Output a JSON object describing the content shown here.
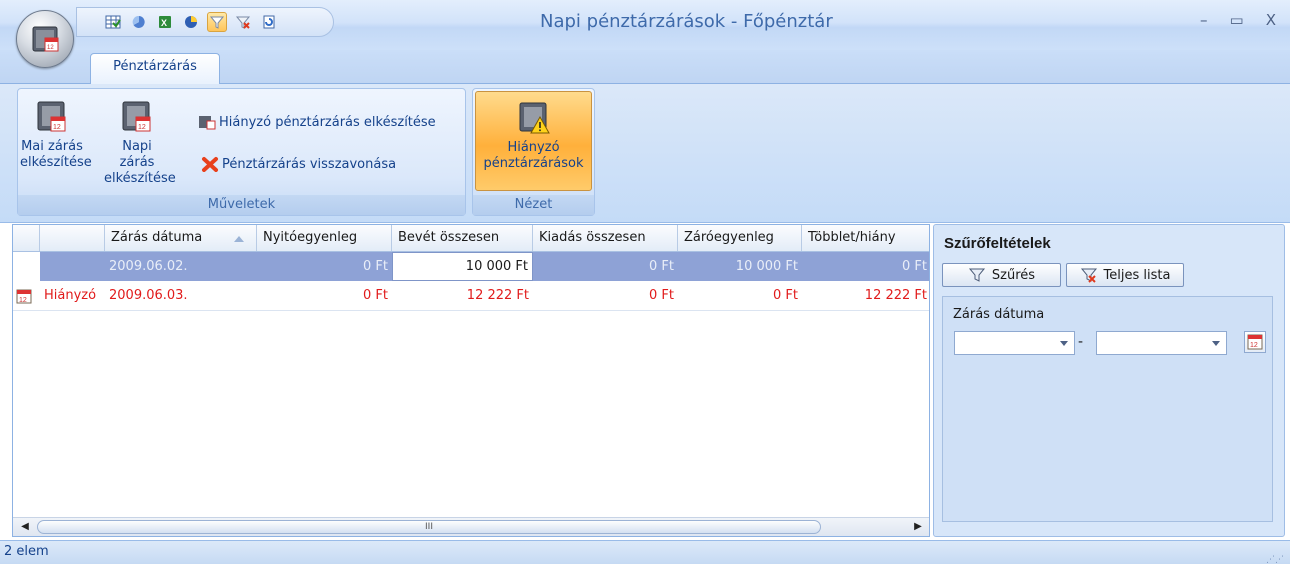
{
  "window": {
    "title": "Napi pénztárzárások - Főpénztár",
    "controls": {
      "minimize": "–",
      "maximize": "▭",
      "close": "X"
    }
  },
  "quick_access": [
    "grid-icon",
    "pie-icon",
    "excel-icon",
    "chart-icon",
    "filter-icon",
    "clear-filter-icon",
    "refresh-icon"
  ],
  "ribbon": {
    "tab": "Pénztárzárás",
    "groups": {
      "muveletek": {
        "label": "Műveletek",
        "mai_zaras": "Mai zárás elkészítése",
        "napi_zaras": "Napi zárás elkészítése",
        "hianyzo_zaras": "Hiányzó pénztárzárás elkészítése",
        "visszavonas": "Pénztárzárás visszavonása"
      },
      "nezet": {
        "label": "Nézet",
        "hianyzo": "Hiányzó pénztárzárások"
      }
    }
  },
  "grid": {
    "columns": [
      "",
      "",
      "Zárás dátuma",
      "Nyitóegyenleg",
      "Bevét összesen",
      "Kiadás összesen",
      "Záróegyenleg",
      "Többlet/hiány"
    ],
    "rows": [
      {
        "status": "",
        "date": "2009.06.02.",
        "open": "0 Ft",
        "income": "10 000 Ft",
        "expense": "0 Ft",
        "close": "10 000 Ft",
        "diff": "0 Ft",
        "selected": true
      },
      {
        "status": "Hiányzó",
        "date": "2009.06.03.",
        "open": "0 Ft",
        "income": "12 222 Ft",
        "expense": "0 Ft",
        "close": "0 Ft",
        "diff": "12 222 Ft",
        "selected": false
      }
    ],
    "scroll_thumb_label": "III"
  },
  "filter": {
    "title": "Szűrőfeltételek",
    "filter_button": "Szűrés",
    "full_list_button": "Teljes lista",
    "field_label": "Zárás dátuma",
    "date_from": "",
    "date_to": "",
    "separator": "-"
  },
  "status": {
    "count": "2 elem"
  },
  "colors": {
    "accent": "#15428b",
    "missing": "#e11b1b",
    "selection": "#8ea2d6",
    "active_button": "#ffb03b"
  }
}
